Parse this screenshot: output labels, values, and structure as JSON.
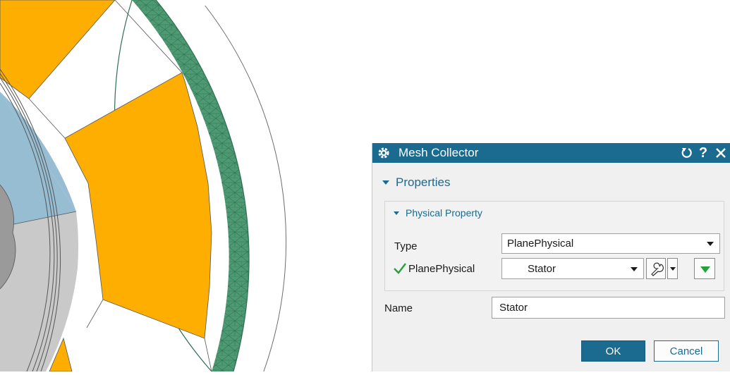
{
  "dialog": {
    "title": "Mesh Collector",
    "icons": {
      "settings": "gear-icon",
      "reset": "reset-icon",
      "help": "help-icon",
      "close": "close-icon"
    },
    "properties": {
      "header": "Properties",
      "physical_property": {
        "header": "Physical Property",
        "type_label": "Type",
        "type_value": "PlanePhysical",
        "plane_label": "PlanePhysical",
        "plane_value": "Stator",
        "plane_status_icon": "check-icon",
        "edit_icon": "wrench-icon"
      },
      "name_label": "Name",
      "name_value": "Stator"
    },
    "ok_label": "OK",
    "cancel_label": "Cancel"
  },
  "colors": {
    "title_bar": "#1b6a8f",
    "accent": "#1b6a8f",
    "ok_button": "#1b6a8f",
    "check": "#22a33a",
    "magnet_orange": "#fdae00",
    "stator_green": "#4e9a73",
    "rotor_blue": "#97bdd2",
    "shaft_gray": "#c9c9c9"
  }
}
